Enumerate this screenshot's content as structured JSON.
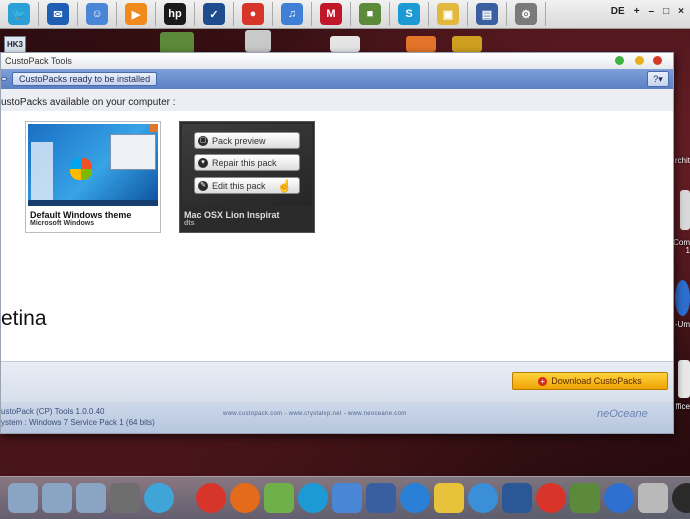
{
  "menubar": {
    "icons": [
      {
        "name": "twitter",
        "color": "#2a9fd8",
        "glyph": "🐦"
      },
      {
        "name": "outlook",
        "color": "#1e5fb3",
        "glyph": "✉"
      },
      {
        "name": "finder",
        "color": "#4a86d6",
        "glyph": "☺"
      },
      {
        "name": "vlc",
        "color": "#f08a1c",
        "glyph": "▶"
      },
      {
        "name": "hp",
        "color": "#1a1a1a",
        "glyph": "hp"
      },
      {
        "name": "stocks",
        "color": "#1f4c8f",
        "glyph": "✓"
      },
      {
        "name": "chrome",
        "color": "#d8352a",
        "glyph": "●"
      },
      {
        "name": "itunes",
        "color": "#3f7fd6",
        "glyph": "♫"
      },
      {
        "name": "mcafee",
        "color": "#c0182a",
        "glyph": "M"
      },
      {
        "name": "minecraft",
        "color": "#5b8a3a",
        "glyph": "■"
      },
      {
        "name": "skype",
        "color": "#1c9ad6",
        "glyph": "S"
      },
      {
        "name": "folder",
        "color": "#e2b93c",
        "glyph": "▣"
      },
      {
        "name": "film",
        "color": "#3a5fa0",
        "glyph": "▤"
      },
      {
        "name": "settings",
        "color": "#7a7a7a",
        "glyph": "⚙"
      }
    ],
    "locale": "DE",
    "right_symbols": [
      "+",
      "–",
      "□",
      "×"
    ]
  },
  "desktop": {
    "hk_icon_label": "HK3",
    "side_labels": [
      "rchit",
      "Com",
      "1",
      "-Um",
      "ffice"
    ]
  },
  "window": {
    "title": "CustoPack Tools",
    "toolbar_button": "CustoPacks ready to be installed",
    "help_label": "?▾",
    "section_title": "ustoPacks available on your computer :",
    "cards": [
      {
        "name": "Default Windows theme",
        "sub": "Microsoft Windows"
      },
      {
        "name": "Mac OSX Lion Inspirat",
        "sub": "dts"
      }
    ],
    "actions": [
      {
        "label": "Pack preview",
        "icon": "▢"
      },
      {
        "label": "Repair this pack",
        "icon": "▾"
      },
      {
        "label": "Edit this pack",
        "icon": "✎"
      }
    ],
    "big_text": "etina",
    "download_button": "Download CustoPacks",
    "status_line1": "ustoPack (CP) Tools 1.0.0.40",
    "status_line2": "ystem : Windows 7 Service Pack 1 (64 bits)",
    "status_links": "www.custopack.com - www.crystalxp.net - www.neoceane.com",
    "brand_logo": "neOceane"
  },
  "dock": {
    "items": [
      "folder",
      "folder",
      "folder",
      "settings",
      "app-round",
      "chrome",
      "firefox",
      "photos",
      "skype",
      "finder",
      "film",
      "ie",
      "stickies",
      "safari",
      "word",
      "app-circles",
      "minecraft",
      "itunes",
      "trash",
      "clock"
    ]
  }
}
